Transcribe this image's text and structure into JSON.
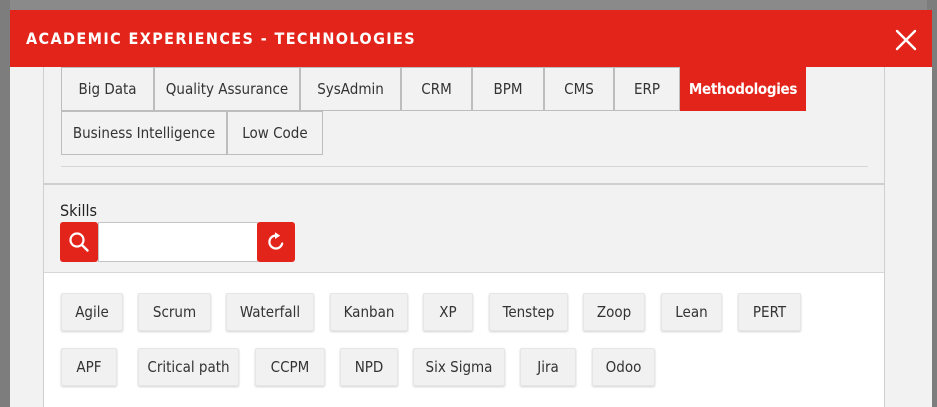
{
  "modal": {
    "title": "ACADEMIC EXPERIENCES - TECHNOLOGIES",
    "close_icon": "close-icon"
  },
  "tabs": [
    {
      "label": "Big Data"
    },
    {
      "label": "Quality Assurance"
    },
    {
      "label": "SysAdmin"
    },
    {
      "label": "CRM"
    },
    {
      "label": "BPM"
    },
    {
      "label": "CMS"
    },
    {
      "label": "ERP"
    },
    {
      "label": "Methodologies",
      "active": true
    },
    {
      "label": "Business Intelligence"
    },
    {
      "label": "Low Code"
    }
  ],
  "skills": {
    "label": "Skills",
    "search_icon": "search-icon",
    "refresh_icon": "refresh-icon",
    "search_value": "",
    "items": [
      "Agile",
      "Scrum",
      "Waterfall",
      "Kanban",
      "XP",
      "Tenstep",
      "Zoop",
      "Lean",
      "PERT",
      "APF",
      "Critical path",
      "CCPM",
      "NPD",
      "Six Sigma",
      "Jira",
      "Odoo"
    ]
  },
  "colors": {
    "accent": "#e3241b",
    "panel_bg": "#f2f2f2",
    "chip_bg": "#f1f1f1"
  }
}
